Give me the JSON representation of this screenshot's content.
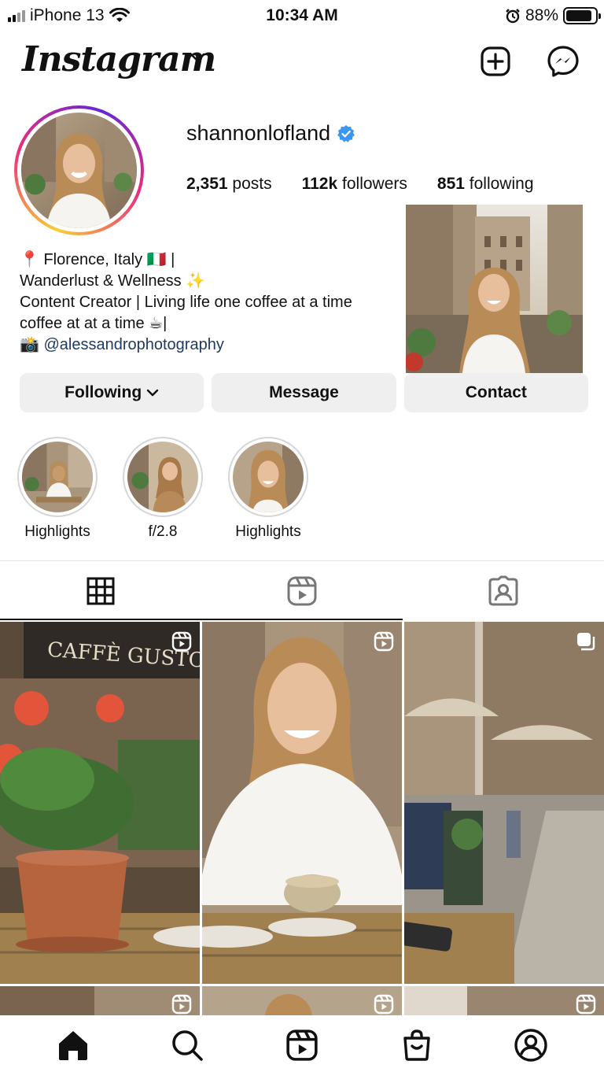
{
  "status_bar": {
    "carrier": "iPhone 13",
    "time": "10:34 AM",
    "battery": "88%",
    "battery_level": 0.88,
    "icons": [
      "signal-icon",
      "wifi-icon",
      "alarm-icon",
      "battery-icon"
    ]
  },
  "header": {
    "logo": "Instagram",
    "icons": [
      "chevron-down-icon",
      "new-post-icon",
      "messenger-icon"
    ]
  },
  "profile": {
    "username": "shannonlofland",
    "verified": true,
    "stats": [
      {
        "value": "2,351",
        "label": "posts"
      },
      {
        "value": "112k",
        "label": "followers"
      },
      {
        "value": "851",
        "label": "following"
      }
    ],
    "bio": {
      "line1": "📍 Florence, Italy 🇮🇹 |",
      "line2": "Wanderlust & Wellness ✨",
      "line3": "Content Creator | Living life one coffee at a time",
      "line4": "coffee at at a time ☕|",
      "line5_icon": "📸",
      "line5_link": "@alessandrophotography"
    }
  },
  "actions": {
    "following": "Following",
    "message": "Message",
    "contact": "Contact"
  },
  "highlights": [
    {
      "label": "Highlights"
    },
    {
      "label": "f/2.8"
    },
    {
      "label": "Highlights"
    }
  ],
  "tabs": [
    "grid-icon",
    "reels-icon",
    "tagged-icon"
  ],
  "bottom_nav": [
    "home-icon",
    "search-icon",
    "reels-icon",
    "shop-icon",
    "profile-icon"
  ],
  "colors": {
    "accent_link": "#1f3b63",
    "verified": "#3897f0",
    "button_bg": "#efefef"
  }
}
